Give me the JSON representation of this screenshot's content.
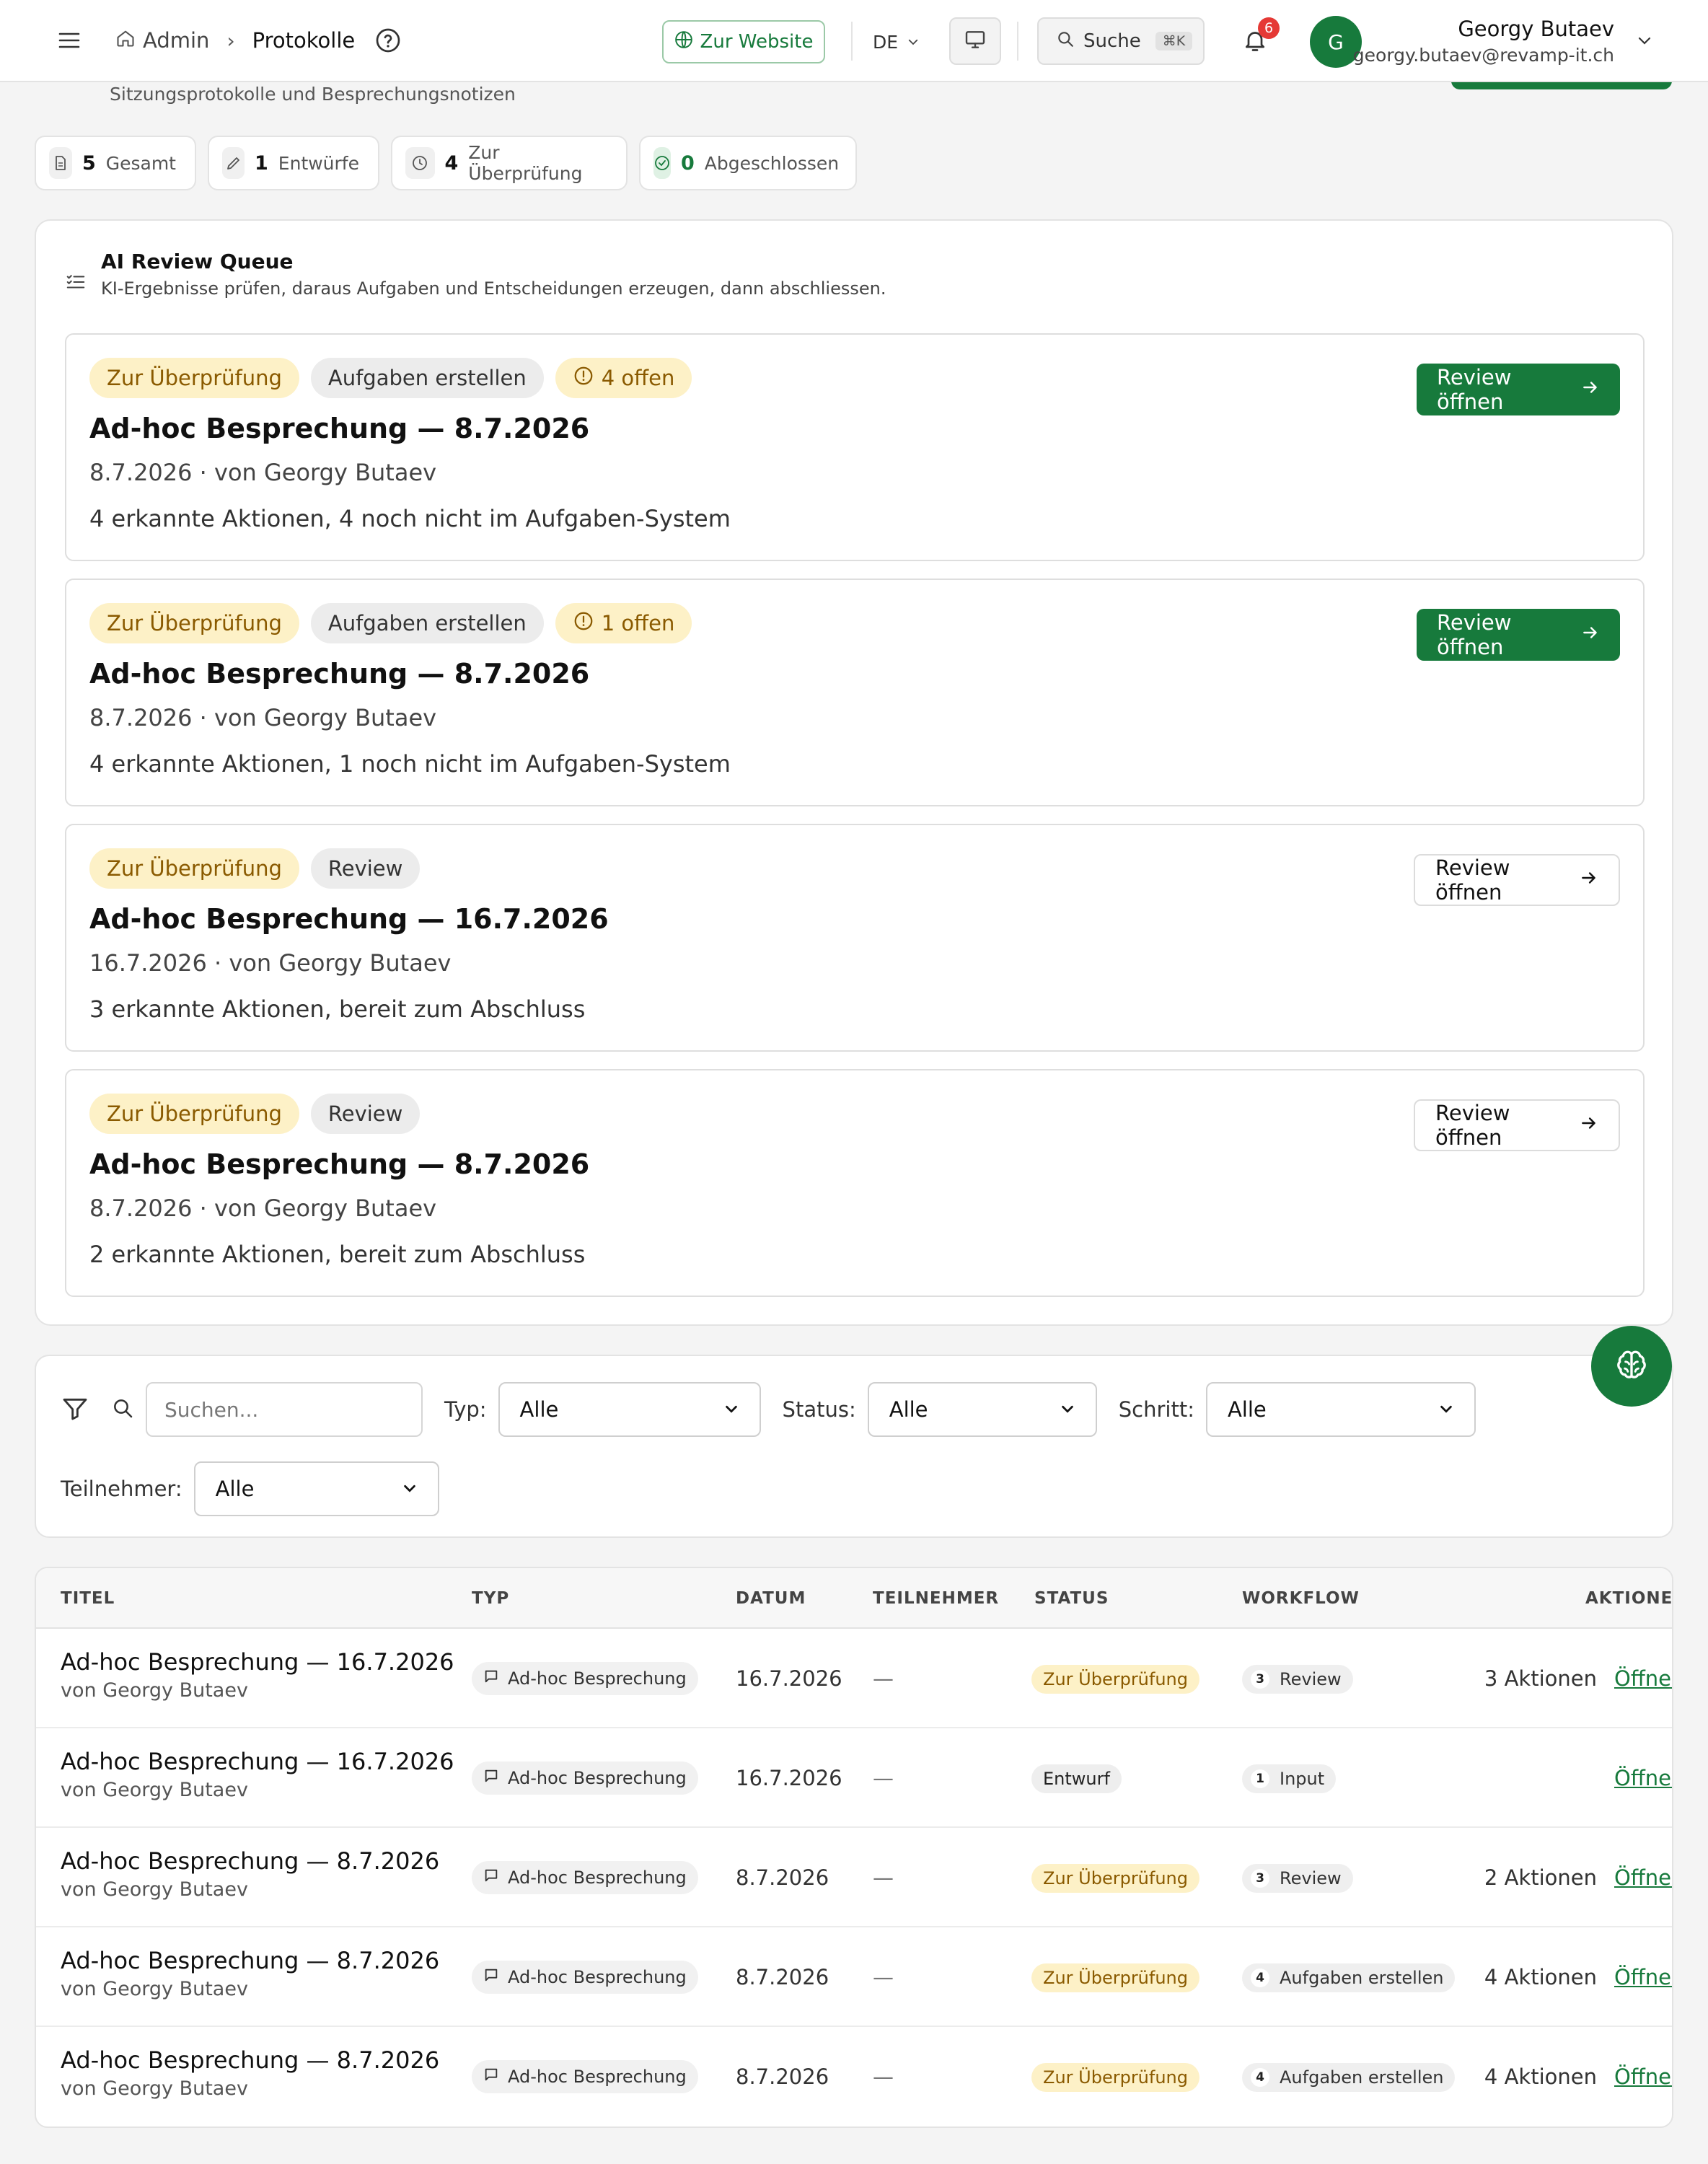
{
  "topbar": {
    "breadcrumb_root": "Admin",
    "breadcrumb_current": "Protokolle",
    "website_label": "Zur Website",
    "language": "DE",
    "search_label": "Suche",
    "search_shortcut": "⌘K",
    "notification_count": "6",
    "avatar_initial": "G",
    "user_name": "Georgy Butaev",
    "user_email": "georgy.butaev@revamp-it.ch"
  },
  "page": {
    "subtitle": "Sitzungsprotokolle und Besprechungsnotizen"
  },
  "stats": [
    {
      "value": "5",
      "label": "Gesamt"
    },
    {
      "value": "1",
      "label": "Entwürfe"
    },
    {
      "value": "4",
      "label": "Zur Überprüfung"
    },
    {
      "value": "0",
      "label": "Abgeschlossen"
    }
  ],
  "queue": {
    "title": "AI Review Queue",
    "description": "KI-Ergebnisse prüfen, daraus Aufgaben und Entscheidungen erzeugen, dann abschliessen.",
    "cards": [
      {
        "status": "Zur Überprüfung",
        "step": "Aufgaben erstellen",
        "open": "4 offen",
        "title": "Ad-hoc Besprechung — 8.7.2026",
        "meta": "8.7.2026 · von Georgy Butaev",
        "info": "4 erkannte Aktionen, 4 noch nicht im Aufgaben-System",
        "button": "Review öffnen"
      },
      {
        "status": "Zur Überprüfung",
        "step": "Aufgaben erstellen",
        "open": "1 offen",
        "title": "Ad-hoc Besprechung — 8.7.2026",
        "meta": "8.7.2026 · von Georgy Butaev",
        "info": "4 erkannte Aktionen, 1 noch nicht im Aufgaben-System",
        "button": "Review öffnen"
      },
      {
        "status": "Zur Überprüfung",
        "step": "Review",
        "open": "",
        "title": "Ad-hoc Besprechung — 16.7.2026",
        "meta": "16.7.2026 · von Georgy Butaev",
        "info": "3 erkannte Aktionen, bereit zum Abschluss",
        "button": "Review öffnen"
      },
      {
        "status": "Zur Überprüfung",
        "step": "Review",
        "open": "",
        "title": "Ad-hoc Besprechung — 8.7.2026",
        "meta": "8.7.2026 · von Georgy Butaev",
        "info": "2 erkannte Aktionen, bereit zum Abschluss",
        "button": "Review öffnen"
      }
    ]
  },
  "filters": {
    "search_placeholder": "Suchen...",
    "type_label": "Typ:",
    "type_value": "Alle",
    "status_label": "Status:",
    "status_value": "Alle",
    "step_label": "Schritt:",
    "step_value": "Alle",
    "participants_label": "Teilnehmer:",
    "participants_value": "Alle"
  },
  "table": {
    "columns": [
      "TITEL",
      "TYP",
      "DATUM",
      "TEILNEHMER",
      "STATUS",
      "WORKFLOW",
      "AKTIONEN"
    ],
    "rows": [
      {
        "title": "Ad-hoc Besprechung — 16.7.2026",
        "author": "von Georgy Butaev",
        "type": "Ad-hoc Besprechung",
        "date": "16.7.2026",
        "participants": "—",
        "status": "Zur Überprüfung",
        "wf_num": "3",
        "wf_label": "Review",
        "actions": "3 Aktionen",
        "open": "Öffnen"
      },
      {
        "title": "Ad-hoc Besprechung — 16.7.2026",
        "author": "von Georgy Butaev",
        "type": "Ad-hoc Besprechung",
        "date": "16.7.2026",
        "participants": "—",
        "status": "Entwurf",
        "wf_num": "1",
        "wf_label": "Input",
        "actions": "",
        "open": "Öffnen"
      },
      {
        "title": "Ad-hoc Besprechung — 8.7.2026",
        "author": "von Georgy Butaev",
        "type": "Ad-hoc Besprechung",
        "date": "8.7.2026",
        "participants": "—",
        "status": "Zur Überprüfung",
        "wf_num": "3",
        "wf_label": "Review",
        "actions": "2 Aktionen",
        "open": "Öffnen"
      },
      {
        "title": "Ad-hoc Besprechung — 8.7.2026",
        "author": "von Georgy Butaev",
        "type": "Ad-hoc Besprechung",
        "date": "8.7.2026",
        "participants": "—",
        "status": "Zur Überprüfung",
        "wf_num": "4",
        "wf_label": "Aufgaben erstellen",
        "actions": "4 Aktionen",
        "open": "Öffnen"
      },
      {
        "title": "Ad-hoc Besprechung — 8.7.2026",
        "author": "von Georgy Butaev",
        "type": "Ad-hoc Besprechung",
        "date": "8.7.2026",
        "participants": "—",
        "status": "Zur Überprüfung",
        "wf_num": "4",
        "wf_label": "Aufgaben erstellen",
        "actions": "4 Aktionen",
        "open": "Öffnen"
      }
    ]
  },
  "colors": {
    "brand": "#177a3c",
    "review_bg": "#fdf1c7",
    "review_text": "#8a5a00",
    "badge": "#e53935"
  }
}
